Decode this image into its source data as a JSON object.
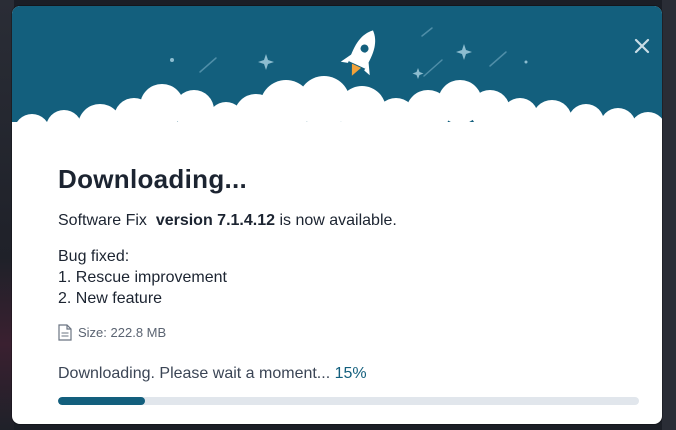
{
  "dialog": {
    "title": "Downloading...",
    "product_name": "Software Fix",
    "version_label": "version 7.1.4.12",
    "availability_text": "is now available.",
    "notes_heading": "Bug fixed:",
    "notes": [
      "1. Rescue improvement",
      "2. New feature"
    ],
    "size_text": "Size: 222.8 MB",
    "status_text": "Downloading. Please wait a moment...",
    "progress_label": "15%",
    "progress_fraction": 0.15
  },
  "icons": {
    "close": "close-icon",
    "rocket": "rocket-icon",
    "file": "file-icon",
    "stars": "star-icon"
  },
  "colors": {
    "header_bg": "#135f7d",
    "accent": "#135f7d",
    "title_text": "#1c2431",
    "progress_track": "#e1e6ec"
  }
}
